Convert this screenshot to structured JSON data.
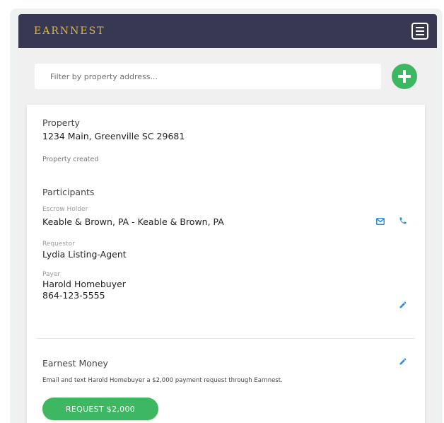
{
  "app": {
    "brand": "EARNNEST"
  },
  "filter": {
    "placeholder": "Filter by property address..."
  },
  "property": {
    "title": "Property",
    "address": "1234 Main, Greenville SC 29681",
    "status": "Property created"
  },
  "participants": {
    "title": "Participants",
    "escrow_holder_label": "Escrow Holder",
    "escrow_holder_value": "Keable & Brown, PA - Keable & Brown, PA",
    "requestor_label": "Requestor",
    "requestor_value": "Lydia Listing-Agent",
    "payer_label": "Payer",
    "payer_name": "Harold Homebuyer",
    "payer_phone": "864-123-5555"
  },
  "earnest_money": {
    "title": "Earnest Money",
    "description": "Email and text Harold Homebuyer a $2,000 payment request through Earnnest.",
    "button_label": "REQUEST $2,000"
  },
  "colors": {
    "appbar": "#383852",
    "brand": "#d6b64a",
    "accent_green": "#3db761",
    "icon_blue": "#2f8fd8"
  },
  "icons": {
    "menu": "menu-lines-icon",
    "add": "plus-icon",
    "email": "mail-icon",
    "phone": "phone-icon",
    "edit": "pencil-icon"
  }
}
